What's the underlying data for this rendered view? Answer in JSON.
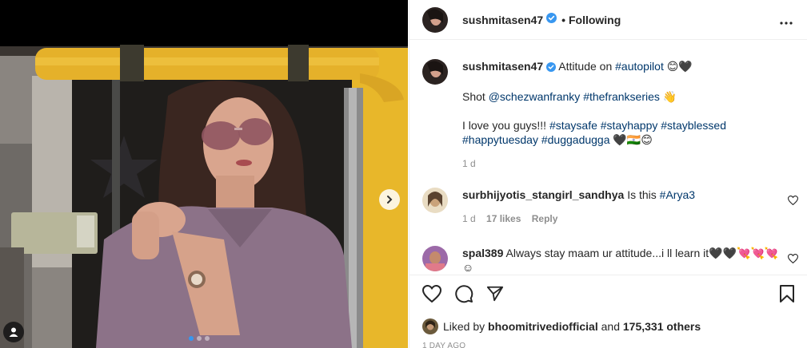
{
  "post": {
    "author": "sushmitasen47",
    "follow_status": "Following",
    "caption": {
      "username": "sushmitasen47",
      "line1_text": "Attitude on ",
      "line1_tag": "#autopilot",
      "line1_emoji": " 😊🖤",
      "line2_prefix": "Shot ",
      "line2_mention": "@schezwanfranky",
      "line2_tag": "#thefrankseries",
      "line2_emoji": " 👋",
      "line3_text": "I love you guys!!! ",
      "line3_tags": "#staysafe #stayhappy #stayblessed",
      "line4_tags": "#happytuesday #duggadugga",
      "line4_emoji": " 🖤🇮🇳😊",
      "age": "1 d"
    },
    "comments": [
      {
        "username": "surbhijyotis_stangirl_sandhya",
        "text": "Is this ",
        "tag": "#Arya3",
        "age": "1 d",
        "likes": "17 likes",
        "reply": "Reply"
      },
      {
        "username": "spal389",
        "text": "Always stay maam ur attitude...i ll learn it🖤🖤💘💘💘☺",
        "text2": "🇮🇳🇮🇳"
      }
    ],
    "liked_by_label": "Liked by ",
    "liked_by_user": "bhoomitrivediofficial",
    "liked_by_and": " and ",
    "liked_by_others": "175,331 others",
    "timestamp": "1 DAY AGO",
    "carousel": {
      "count": 3,
      "active": 0
    }
  },
  "colors": {
    "link": "#00376b",
    "verified": "#3897f0",
    "muted": "#8e8e8e",
    "rickshaw_yellow": "#e8b72a",
    "shirt_mauve": "#8c7288"
  }
}
